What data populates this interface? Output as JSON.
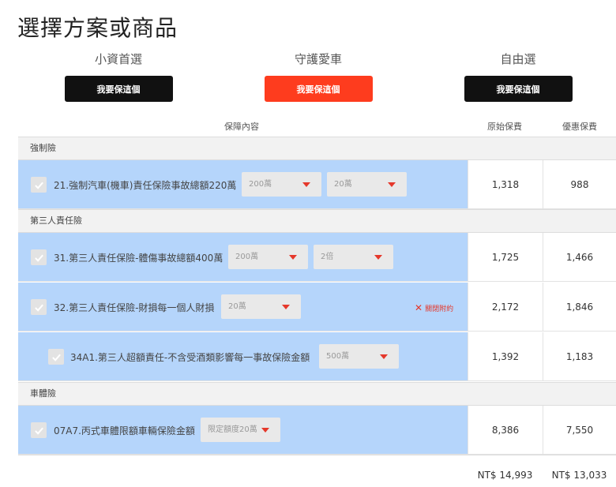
{
  "page_title": "選擇方案或商品",
  "plans": [
    {
      "name": "小資首選",
      "button": "我要保這個"
    },
    {
      "name": "守護愛車",
      "button": "我要保這個"
    },
    {
      "name": "自由選",
      "button": "我要保這個"
    }
  ],
  "columns": {
    "coverage": "保障內容",
    "original": "原始保費",
    "discount": "優惠保費"
  },
  "sections": {
    "compulsory": "強制險",
    "third_party": "第三人責任險",
    "vehicle": "車體險"
  },
  "rows": [
    {
      "label": "21.強制汽車(機車)責任保險事故總額220萬",
      "select1": "200萬",
      "select2": "20萬",
      "original": "1,318",
      "discount": "988"
    },
    {
      "label": "31.第三人責任保險-體傷事故總額400萬",
      "select1": "200萬",
      "select2": "2倍",
      "original": "1,725",
      "discount": "1,466"
    },
    {
      "label": "32.第三人責任保險-財損每一個人財損",
      "select1": "20萬",
      "close_label": "關閉附約",
      "original": "2,172",
      "discount": "1,846"
    },
    {
      "label": "34A1.第三人超額責任-不含受酒類影響每一事故保險金額",
      "select1": "500萬",
      "original": "1,392",
      "discount": "1,183"
    },
    {
      "label": "07A7.丙式車體限額車輛保險金額",
      "select1": "限定額度20萬",
      "original": "8,386",
      "discount": "7,550"
    }
  ],
  "totals": {
    "original": "NT$ 14,993",
    "discount": "NT$ 13,033"
  },
  "colors": {
    "accent": "#fe3c1e",
    "row_highlight": "#b5d5fb",
    "arrow": "#e5382b"
  }
}
